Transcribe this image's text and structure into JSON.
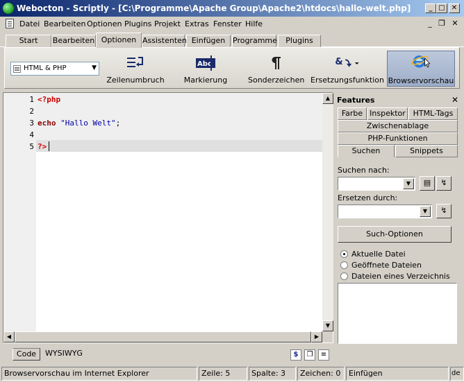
{
  "window": {
    "title": "Webocton - Scriptly - [C:\\Programme\\Apache Group\\Apache2\\htdocs\\hallo-welt.php]",
    "minimize": "_",
    "maximize": "□",
    "close": "✕"
  },
  "menu": {
    "items": [
      "Datei",
      "Bearbeiten",
      "Optionen",
      "Plugins",
      "Projekt",
      "Extras",
      "Fenster",
      "Hilfe"
    ],
    "mdi": {
      "minimize": "_",
      "restore": "❐",
      "close": "✕"
    }
  },
  "ribbon_tabs": [
    "Start",
    "Bearbeiten",
    "Optionen",
    "Assistenten",
    "Einfügen",
    "Programme",
    "Plugins"
  ],
  "ribbon": {
    "language": "HTML & PHP",
    "buttons": [
      {
        "label": "Zeilenumbruch",
        "icon": "line-break-icon"
      },
      {
        "label": "Markierung",
        "icon": "highlight-icon"
      },
      {
        "label": "Sonderzeichen",
        "icon": "pilcrow-icon"
      },
      {
        "label": "Ersetzungsfunktion",
        "icon": "replace-icon"
      },
      {
        "label": "Browservorschau",
        "icon": "internet-explorer-icon"
      }
    ]
  },
  "editor": {
    "lines": [
      {
        "num": "1",
        "text": "<?php"
      },
      {
        "num": "2",
        "text": ""
      },
      {
        "num": "3",
        "keyword": "echo",
        "string": "\"Hallo Welt\"",
        "tail": ";"
      },
      {
        "num": "4",
        "text": ""
      },
      {
        "num": "5",
        "text": "?>"
      }
    ]
  },
  "bottom_tabs": [
    "Code",
    "WYSIWYG"
  ],
  "features": {
    "title": "Features",
    "close": "✕",
    "tabs_row1": [
      "Farbe",
      "Inspektor",
      "HTML-Tags"
    ],
    "tabs_row2": [
      "Zwischenablage"
    ],
    "tabs_row3": [
      "PHP-Funktionen"
    ],
    "tabs_row4": [
      "Suchen",
      "Snippets"
    ],
    "search_label": "Suchen nach:",
    "search_value": "",
    "replace_label": "Ersetzen durch:",
    "replace_value": "",
    "options_button": "Such-Optionen",
    "scope_options": [
      "Aktuelle Datei",
      "Geöffnete Dateien",
      "Dateien eines Verzeichnis"
    ],
    "scope_selected": 0
  },
  "status": {
    "message": "Browservorschau im Internet Explorer",
    "line": "Zeile: 5",
    "column": "Spalte: 3",
    "chars": "Zeichen: 0",
    "mode": "Einfügen",
    "lang": "de"
  },
  "colors": {
    "title_start": "#0a246a",
    "title_end": "#a6caf0",
    "php_tag": "#cc0000",
    "string": "#0000aa"
  }
}
